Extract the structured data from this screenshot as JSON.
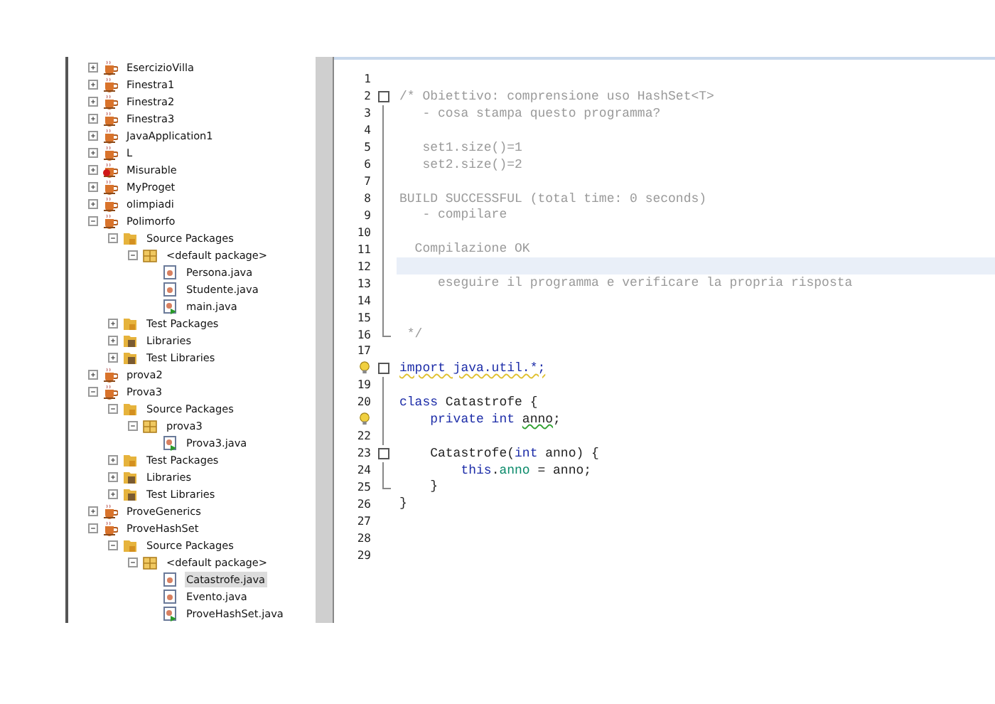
{
  "project_tree": [
    {
      "label": "EsercizioVilla",
      "kind": "project",
      "expanded": false,
      "error": false
    },
    {
      "label": "Finestra1",
      "kind": "project",
      "expanded": false,
      "error": false
    },
    {
      "label": "Finestra2",
      "kind": "project",
      "expanded": false,
      "error": false
    },
    {
      "label": "Finestra3",
      "kind": "project",
      "expanded": false,
      "error": false
    },
    {
      "label": "JavaApplication1",
      "kind": "project",
      "expanded": false,
      "error": false
    },
    {
      "label": "L",
      "kind": "project",
      "expanded": false,
      "error": false
    },
    {
      "label": "Misurable",
      "kind": "project",
      "expanded": false,
      "error": true
    },
    {
      "label": "MyProget",
      "kind": "project",
      "expanded": false,
      "error": false
    },
    {
      "label": "olimpiadi",
      "kind": "project",
      "expanded": false,
      "error": false
    },
    {
      "label": "Polimorfo",
      "kind": "project",
      "expanded": true,
      "error": false,
      "children": [
        {
          "label": "Source Packages",
          "kind": "folder",
          "expanded": true,
          "children": [
            {
              "label": "<default package>",
              "kind": "package",
              "expanded": true,
              "children": [
                {
                  "label": "Persona.java",
                  "kind": "file",
                  "selected": false
                },
                {
                  "label": "Studente.java",
                  "kind": "file",
                  "selected": false
                },
                {
                  "label": "main.java",
                  "kind": "mainfile",
                  "selected": false
                }
              ]
            }
          ]
        },
        {
          "label": "Test Packages",
          "kind": "folder",
          "expanded": false
        },
        {
          "label": "Libraries",
          "kind": "library",
          "expanded": false
        },
        {
          "label": "Test Libraries",
          "kind": "library",
          "expanded": false
        }
      ]
    },
    {
      "label": "prova2",
      "kind": "project",
      "expanded": false,
      "error": false
    },
    {
      "label": "Prova3",
      "kind": "project",
      "expanded": true,
      "error": false,
      "children": [
        {
          "label": "Source Packages",
          "kind": "folder",
          "expanded": true,
          "children": [
            {
              "label": "prova3",
              "kind": "package",
              "expanded": true,
              "children": [
                {
                  "label": "Prova3.java",
                  "kind": "mainfile",
                  "selected": false
                }
              ]
            }
          ]
        },
        {
          "label": "Test Packages",
          "kind": "folder",
          "expanded": false
        },
        {
          "label": "Libraries",
          "kind": "library",
          "expanded": false
        },
        {
          "label": "Test Libraries",
          "kind": "library",
          "expanded": false
        }
      ]
    },
    {
      "label": "ProveGenerics",
      "kind": "project",
      "expanded": false,
      "error": false
    },
    {
      "label": "ProveHashSet",
      "kind": "project",
      "expanded": true,
      "error": false,
      "children": [
        {
          "label": "Source Packages",
          "kind": "folder",
          "expanded": true,
          "children": [
            {
              "label": "<default package>",
              "kind": "package",
              "expanded": true,
              "children": [
                {
                  "label": "Catastrofe.java",
                  "kind": "file",
                  "selected": true
                },
                {
                  "label": "Evento.java",
                  "kind": "file",
                  "selected": false
                },
                {
                  "label": "ProveHashSet.java",
                  "kind": "mainfile",
                  "selected": false
                }
              ]
            }
          ]
        }
      ]
    }
  ],
  "editor": {
    "lines": [
      {
        "number": "1",
        "hint": false,
        "current": false,
        "fold_start": false,
        "fold_end": false
      },
      {
        "number": "2",
        "hint": false,
        "current": false,
        "fold_start": true,
        "fold_end": false,
        "segments": [
          {
            "kind": "comment",
            "text": "/* Obiettivo: comprensione uso HashSet<T>"
          }
        ]
      },
      {
        "number": "3",
        "hint": false,
        "current": false,
        "fold_start": false,
        "fold_end": false,
        "segments": [
          {
            "kind": "comment",
            "text": "   - cosa stampa questo programma?"
          }
        ]
      },
      {
        "number": "4",
        "hint": false,
        "current": false,
        "fold_start": false,
        "fold_end": false
      },
      {
        "number": "5",
        "hint": false,
        "current": false,
        "fold_start": false,
        "fold_end": false,
        "segments": [
          {
            "kind": "comment",
            "text": "   set1.size()=1"
          }
        ]
      },
      {
        "number": "6",
        "hint": false,
        "current": false,
        "fold_start": false,
        "fold_end": false,
        "segments": [
          {
            "kind": "comment",
            "text": "   set2.size()=2"
          }
        ]
      },
      {
        "number": "7",
        "hint": false,
        "current": false,
        "fold_start": false,
        "fold_end": false
      },
      {
        "number": "8",
        "hint": false,
        "current": false,
        "fold_start": false,
        "fold_end": false,
        "segments": [
          {
            "kind": "comment",
            "text": "BUILD SUCCESSFUL (total time: 0 seconds)"
          }
        ]
      },
      {
        "number": "9",
        "hint": false,
        "current": false,
        "fold_start": false,
        "fold_end": false,
        "segments": [
          {
            "kind": "comment",
            "text": "   - compilare"
          }
        ]
      },
      {
        "number": "10",
        "hint": false,
        "current": false,
        "fold_start": false,
        "fold_end": false
      },
      {
        "number": "11",
        "hint": false,
        "current": false,
        "fold_start": false,
        "fold_end": false,
        "segments": [
          {
            "kind": "comment",
            "text": "  Compilazione OK"
          }
        ]
      },
      {
        "number": "12",
        "hint": false,
        "current": true,
        "fold_start": false,
        "fold_end": false
      },
      {
        "number": "13",
        "hint": false,
        "current": false,
        "fold_start": false,
        "fold_end": false,
        "segments": [
          {
            "kind": "comment",
            "text": "     eseguire il programma e verificare la propria risposta"
          }
        ]
      },
      {
        "number": "14",
        "hint": false,
        "current": false,
        "fold_start": false,
        "fold_end": false
      },
      {
        "number": "15",
        "hint": false,
        "current": false,
        "fold_start": false,
        "fold_end": false
      },
      {
        "number": "16",
        "hint": false,
        "current": false,
        "fold_start": false,
        "fold_end": true,
        "segments": [
          {
            "kind": "comment",
            "text": " */"
          }
        ]
      },
      {
        "number": "17",
        "hint": false,
        "current": false,
        "fold_start": false,
        "fold_end": false
      },
      {
        "hint": true,
        "current": false,
        "fold_start": true,
        "fold_end": false,
        "segments": [
          {
            "kind": "warning",
            "text": "import java.util.*;"
          }
        ]
      },
      {
        "number": "19",
        "hint": false,
        "current": false,
        "fold_start": false,
        "fold_end": false
      },
      {
        "number": "20",
        "hint": false,
        "current": false,
        "fold_start": false,
        "fold_end": false,
        "segments": [
          {
            "kind": "keyword",
            "text": "class"
          },
          {
            "kind": "plain",
            "text": " Catastrofe {"
          }
        ]
      },
      {
        "hint": true,
        "current": false,
        "fold_start": false,
        "fold_end": false,
        "segments": [
          {
            "kind": "keyword",
            "text": "    private int "
          },
          {
            "kind": "unused",
            "text": "anno"
          },
          {
            "kind": "plain",
            "text": ";"
          }
        ]
      },
      {
        "number": "22",
        "hint": false,
        "current": false,
        "fold_start": false,
        "fold_end": false
      },
      {
        "number": "23",
        "hint": false,
        "current": false,
        "fold_start": true,
        "fold_end": false,
        "segments": [
          {
            "kind": "plain",
            "text": "    Catastrofe("
          },
          {
            "kind": "keyword",
            "text": "int"
          },
          {
            "kind": "plain",
            "text": " anno) {"
          }
        ]
      },
      {
        "number": "24",
        "hint": false,
        "current": false,
        "fold_start": false,
        "fold_end": false,
        "segments": [
          {
            "kind": "keyword",
            "text": "        this"
          },
          {
            "kind": "plain",
            "text": "."
          },
          {
            "kind": "field",
            "text": "anno"
          },
          {
            "kind": "plain",
            "text": " = anno;"
          }
        ]
      },
      {
        "number": "25",
        "hint": false,
        "current": false,
        "fold_start": false,
        "fold_end": true,
        "segments": [
          {
            "kind": "plain",
            "text": "    }"
          }
        ]
      },
      {
        "number": "26",
        "hint": false,
        "current": false,
        "fold_start": false,
        "fold_end": false,
        "segments": [
          {
            "kind": "plain",
            "text": "}"
          }
        ]
      },
      {
        "number": "27",
        "hint": false,
        "current": false,
        "fold_start": false,
        "fold_end": false
      },
      {
        "number": "28",
        "hint": false,
        "current": false,
        "fold_start": false,
        "fold_end": false
      },
      {
        "number": "29",
        "hint": false,
        "current": false,
        "fold_start": false,
        "fold_end": false
      }
    ]
  }
}
